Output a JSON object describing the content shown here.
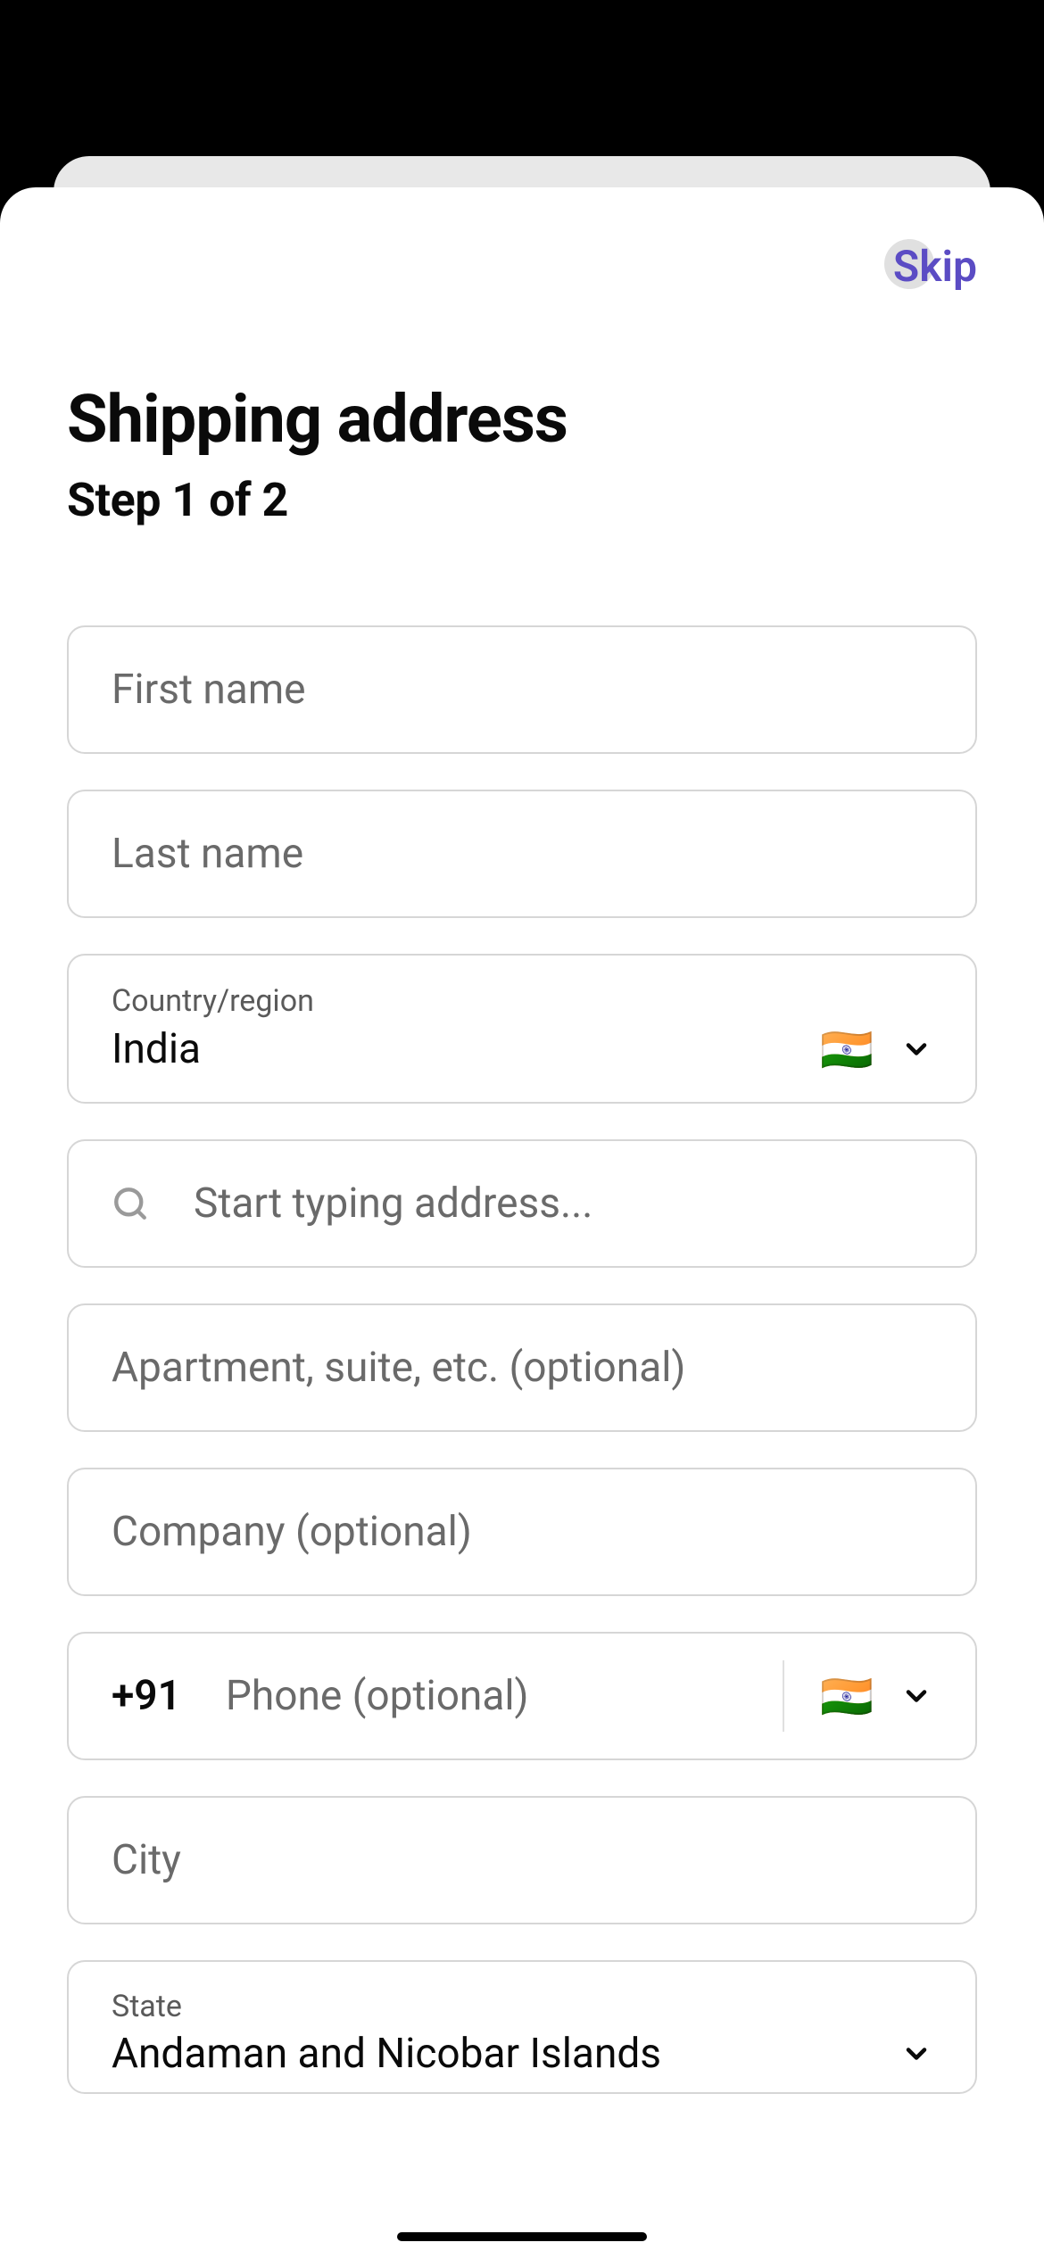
{
  "header": {
    "skip_label": "Skip"
  },
  "page": {
    "title": "Shipping address",
    "step": "Step 1 of 2"
  },
  "form": {
    "first_name_placeholder": "First name",
    "last_name_placeholder": "Last name",
    "country_label": "Country/region",
    "country_value": "India",
    "country_flag": "🇮🇳",
    "address_search_placeholder": "Start typing address...",
    "apartment_placeholder": "Apartment, suite, etc. (optional)",
    "company_placeholder": "Company (optional)",
    "phone_code": "+91",
    "phone_placeholder": "Phone (optional)",
    "phone_flag": "🇮🇳",
    "city_placeholder": "City",
    "state_label": "State",
    "state_value": "Andaman and Nicobar Islands"
  }
}
